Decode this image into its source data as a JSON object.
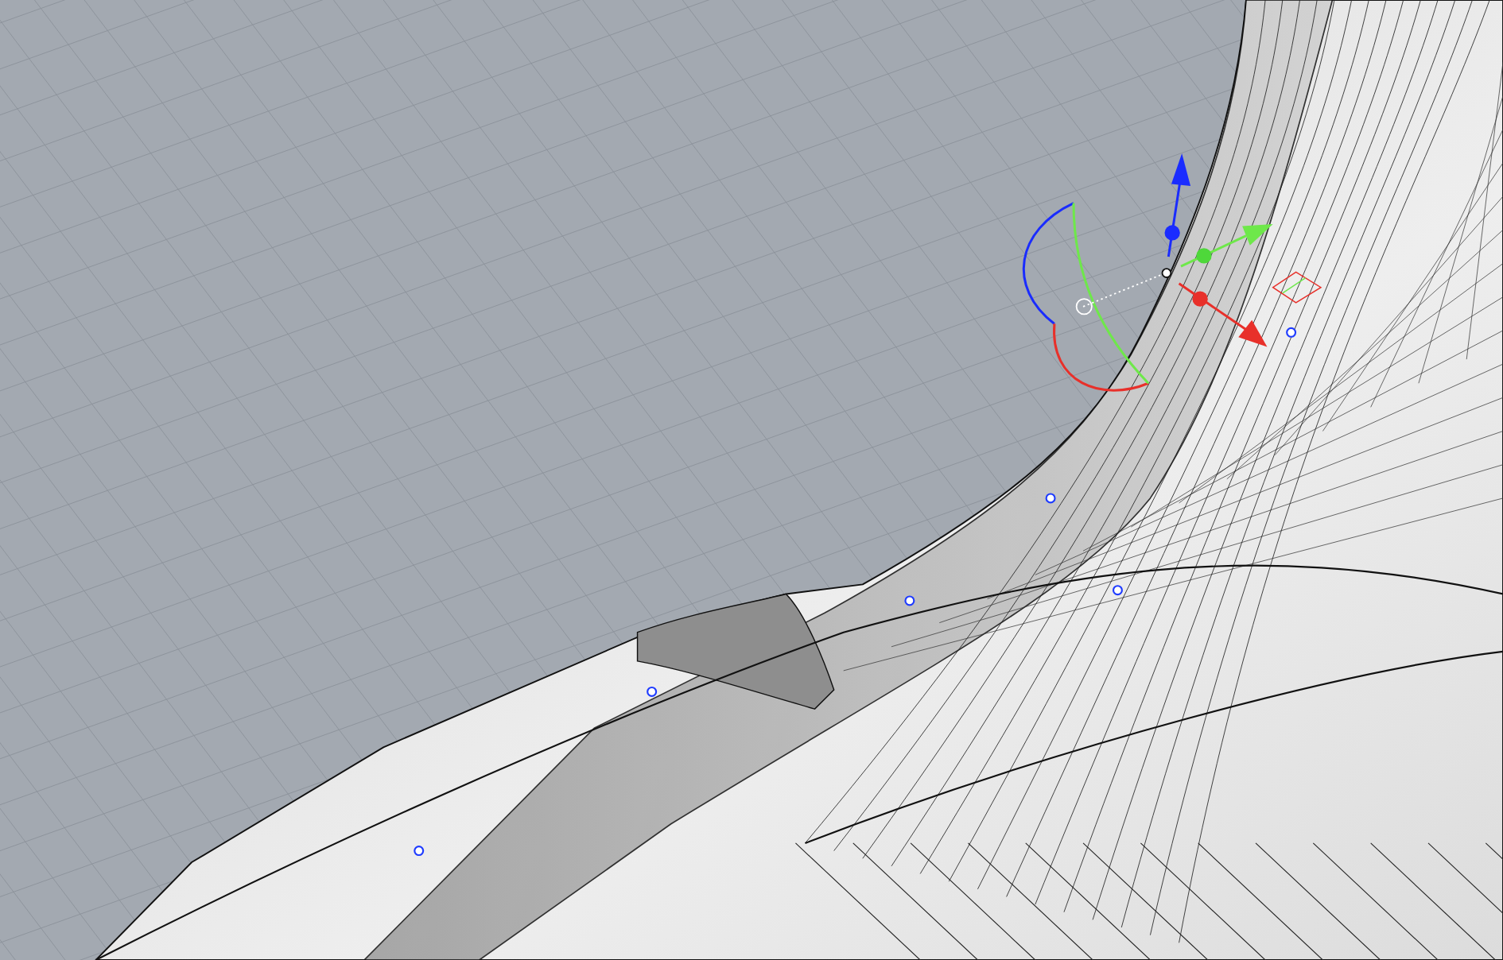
{
  "viewport": {
    "grid_visible": true,
    "gizmo_visible": true,
    "control_points_visible": true
  }
}
